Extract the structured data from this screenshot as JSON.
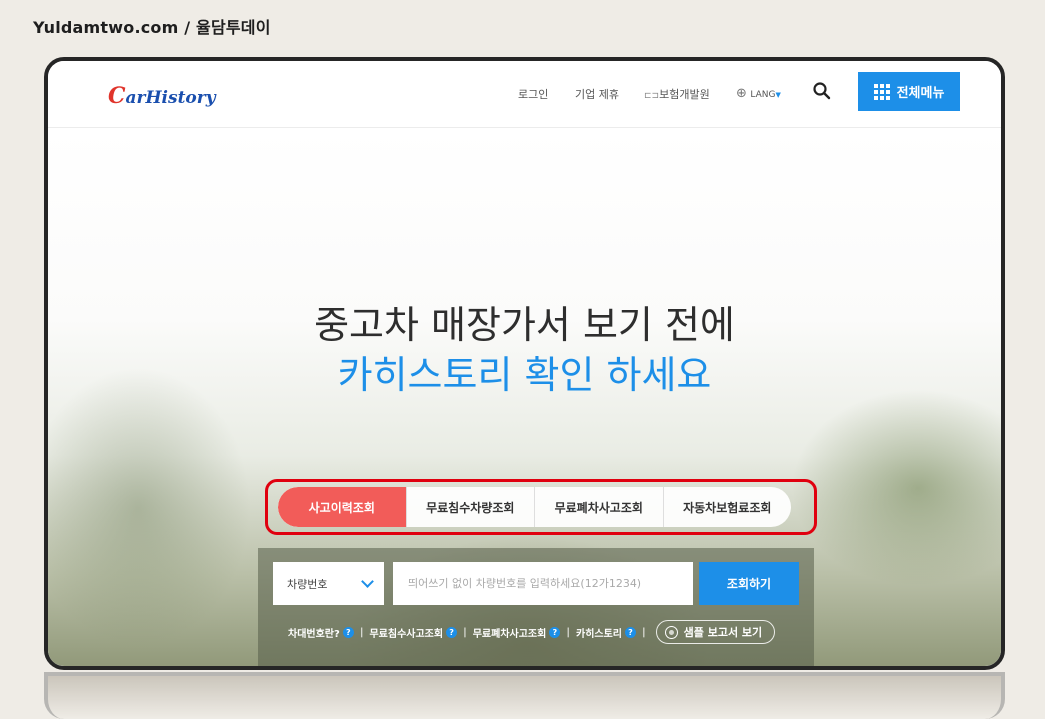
{
  "watermark": "Yuldamtwo.com / 율담투데이",
  "header": {
    "logo_c": "C",
    "logo_rest": "arHistory",
    "nav": {
      "login": "로그인",
      "partnership": "기업 제휴",
      "insurance_dev": "보험개발원",
      "lang": "LANG"
    },
    "menu_label": "전체메뉴"
  },
  "hero": {
    "headline_line1": "중고차 매장가서 보기 전에",
    "headline_line2": "카히스토리 확인 하세요"
  },
  "tabs": [
    {
      "label": "사고이력조회",
      "active": true
    },
    {
      "label": "무료침수차량조회",
      "active": false
    },
    {
      "label": "무료폐차사고조회",
      "active": false
    },
    {
      "label": "자동차보험료조회",
      "active": false
    }
  ],
  "search": {
    "type_selected": "차량번호",
    "placeholder": "띄어쓰기 없이 차량번호를 입력하세요(12가1234)",
    "submit_label": "조회하기"
  },
  "links": [
    {
      "label": "차대번호란?"
    },
    {
      "label": "무료침수사고조회"
    },
    {
      "label": "무료폐차사고조회"
    },
    {
      "label": "카히스토리"
    }
  ],
  "links_separator": "|",
  "help_mark": "?",
  "sample_button": "샘플 보고서 보기",
  "colors": {
    "accent_blue": "#1d8fe8",
    "active_tab": "#f25c59",
    "highlight_border": "#e0000f",
    "logo_blue": "#1a4fae",
    "logo_red": "#e0342b"
  }
}
